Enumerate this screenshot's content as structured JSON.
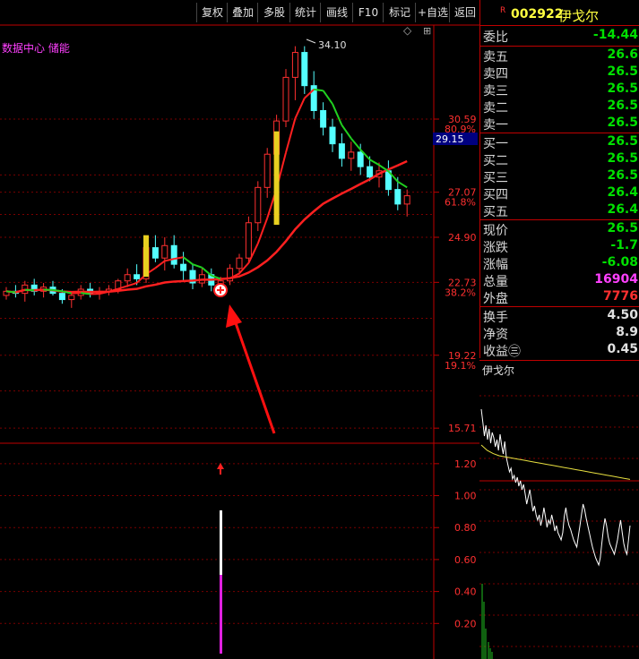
{
  "toolbar": {
    "items": [
      "复权",
      "叠加",
      "多股",
      "统计",
      "画线",
      "F10",
      "标记",
      "+自选",
      "返回"
    ]
  },
  "chart": {
    "indicator_label": "数据中心 储能",
    "high_label": "34.10",
    "price_axis": [
      {
        "price": "30.59",
        "pct": "80.9%"
      },
      {
        "price": "27.07",
        "pct": "61.8%"
      },
      {
        "price": "24.90",
        "pct": ""
      },
      {
        "price": "22.73",
        "pct": "38.2%"
      },
      {
        "price": "19.22",
        "pct": "19.1%"
      },
      {
        "price": "15.71",
        "pct": ""
      }
    ],
    "current_price": "29.15",
    "indicator_axis": [
      "1.20",
      "1.00",
      "0.80",
      "0.60",
      "0.40",
      "0.20"
    ],
    "colors": {
      "up": "#ff3030",
      "down": "#54ffff",
      "ma_red": "#ff2020",
      "ma_green": "#20d020",
      "highlight": "#e8d020"
    }
  },
  "chart_data": {
    "type": "candlestick",
    "candles": [
      [
        22.1,
        22.5,
        21.9,
        22.3
      ],
      [
        22.3,
        22.6,
        22.0,
        22.2
      ],
      [
        22.2,
        22.8,
        21.8,
        22.6
      ],
      [
        22.6,
        22.9,
        22.1,
        22.3
      ],
      [
        22.3,
        22.7,
        22.0,
        22.5
      ],
      [
        22.5,
        22.8,
        22.1,
        22.2
      ],
      [
        22.2,
        22.4,
        21.7,
        21.9
      ],
      [
        21.9,
        22.3,
        21.5,
        22.1
      ],
      [
        22.1,
        22.6,
        21.9,
        22.4
      ],
      [
        22.4,
        22.7,
        22.0,
        22.2
      ],
      [
        22.2,
        22.5,
        21.9,
        22.3
      ],
      [
        22.3,
        22.6,
        22.1,
        22.4
      ],
      [
        22.4,
        22.9,
        22.2,
        22.8
      ],
      [
        22.8,
        23.4,
        22.5,
        23.1
      ],
      [
        23.1,
        23.6,
        22.6,
        22.9
      ],
      [
        22.9,
        24.6,
        22.7,
        24.4
      ],
      [
        24.4,
        25.0,
        23.7,
        23.9
      ],
      [
        23.9,
        24.9,
        23.3,
        24.5
      ],
      [
        24.5,
        25.0,
        23.4,
        23.6
      ],
      [
        23.6,
        24.2,
        22.8,
        23.3
      ],
      [
        23.3,
        23.6,
        22.4,
        22.7
      ],
      [
        22.7,
        23.4,
        22.5,
        23.1
      ],
      [
        23.1,
        23.4,
        22.3,
        22.6
      ],
      [
        22.6,
        23.0,
        22.2,
        22.8
      ],
      [
        22.8,
        23.6,
        22.6,
        23.4
      ],
      [
        23.4,
        24.1,
        23.1,
        23.9
      ],
      [
        23.9,
        25.9,
        23.7,
        25.6
      ],
      [
        25.6,
        27.6,
        25.2,
        27.3
      ],
      [
        27.3,
        29.2,
        26.8,
        28.9
      ],
      [
        28.9,
        30.8,
        28.4,
        30.5
      ],
      [
        30.5,
        33.0,
        30.2,
        32.6
      ],
      [
        32.6,
        34.1,
        31.5,
        33.8
      ],
      [
        33.8,
        34.1,
        31.8,
        32.2
      ],
      [
        32.2,
        32.9,
        30.6,
        31.0
      ],
      [
        31.0,
        31.4,
        29.8,
        30.2
      ],
      [
        30.2,
        30.6,
        29.0,
        29.4
      ],
      [
        29.4,
        29.9,
        28.3,
        28.7
      ],
      [
        28.7,
        29.5,
        28.1,
        29.0
      ],
      [
        29.0,
        29.4,
        27.9,
        28.3
      ],
      [
        28.3,
        28.8,
        27.6,
        27.8
      ],
      [
        27.8,
        28.5,
        27.3,
        28.1
      ],
      [
        28.1,
        28.6,
        26.9,
        27.2
      ],
      [
        27.2,
        27.8,
        26.2,
        26.5
      ],
      [
        26.5,
        27.2,
        25.9,
        26.9
      ]
    ],
    "ma_short_green_segments": true,
    "minute_line": [
      0.95,
      0.88,
      0.8,
      0.86,
      0.78,
      0.84,
      0.76,
      0.82,
      0.79,
      0.74,
      0.78,
      0.72,
      0.81,
      0.75,
      0.7,
      0.77,
      0.68,
      0.64,
      0.6,
      0.62,
      0.56,
      0.58,
      0.54,
      0.57,
      0.52,
      0.55,
      0.5,
      0.53,
      0.48,
      0.42,
      0.46,
      0.5,
      0.44,
      0.38,
      0.41,
      0.36,
      0.33,
      0.36,
      0.3,
      0.34,
      0.4,
      0.35,
      0.29,
      0.33,
      0.31,
      0.36,
      0.32,
      0.27,
      0.3,
      0.26,
      0.24,
      0.22,
      0.26,
      0.35,
      0.4,
      0.34,
      0.3,
      0.28,
      0.25,
      0.22,
      0.2,
      0.18,
      0.24,
      0.3,
      0.36,
      0.42,
      0.39,
      0.34,
      0.3,
      0.26,
      0.22,
      0.18,
      0.15,
      0.12,
      0.1,
      0.08,
      0.12,
      0.2,
      0.28,
      0.34,
      0.3,
      0.24,
      0.2,
      0.18,
      0.16,
      0.14,
      0.18,
      0.22,
      0.28,
      0.33,
      0.26,
      0.2,
      0.16,
      0.14,
      0.22,
      0.3
    ],
    "minute_avg": [
      0.9,
      0.85,
      0.82,
      0.8,
      0.79,
      0.78,
      0.77,
      0.76,
      0.75,
      0.74,
      0.73,
      0.72,
      0.71,
      0.7,
      0.69,
      0.68,
      0.67,
      0.66,
      0.65,
      0.64,
      0.63,
      0.62,
      0.61,
      0.6,
      0.59,
      0.58
    ]
  },
  "quote": {
    "symbol_code": "002922",
    "symbol_name": "伊戈尔",
    "r_badge": "R",
    "weibi": {
      "label": "委比",
      "value": "-14.44"
    },
    "sells": [
      {
        "label": "卖五",
        "value": "26.6"
      },
      {
        "label": "卖四",
        "value": "26.5"
      },
      {
        "label": "卖三",
        "value": "26.5"
      },
      {
        "label": "卖二",
        "value": "26.5"
      },
      {
        "label": "卖一",
        "value": "26.5"
      }
    ],
    "buys": [
      {
        "label": "买一",
        "value": "26.5"
      },
      {
        "label": "买二",
        "value": "26.5"
      },
      {
        "label": "买三",
        "value": "26.5"
      },
      {
        "label": "买四",
        "value": "26.4"
      },
      {
        "label": "买五",
        "value": "26.4"
      }
    ],
    "stats": [
      {
        "label": "现价",
        "value": "26.5",
        "color": "#00e000"
      },
      {
        "label": "涨跌",
        "value": "-1.7",
        "color": "#00e000"
      },
      {
        "label": "涨幅",
        "value": "-6.08",
        "color": "#00e000"
      },
      {
        "label": "总量",
        "value": "16904",
        "color": "#ff40ff"
      },
      {
        "label": "外盘",
        "value": "7776",
        "color": "#ff3030"
      }
    ],
    "extra": [
      {
        "label": "换手",
        "value": "4.50"
      },
      {
        "label": "净资",
        "value": "8.9"
      },
      {
        "label": "收益㊂",
        "value": "0.45"
      }
    ]
  },
  "mini": {
    "title": "伊戈尔"
  }
}
